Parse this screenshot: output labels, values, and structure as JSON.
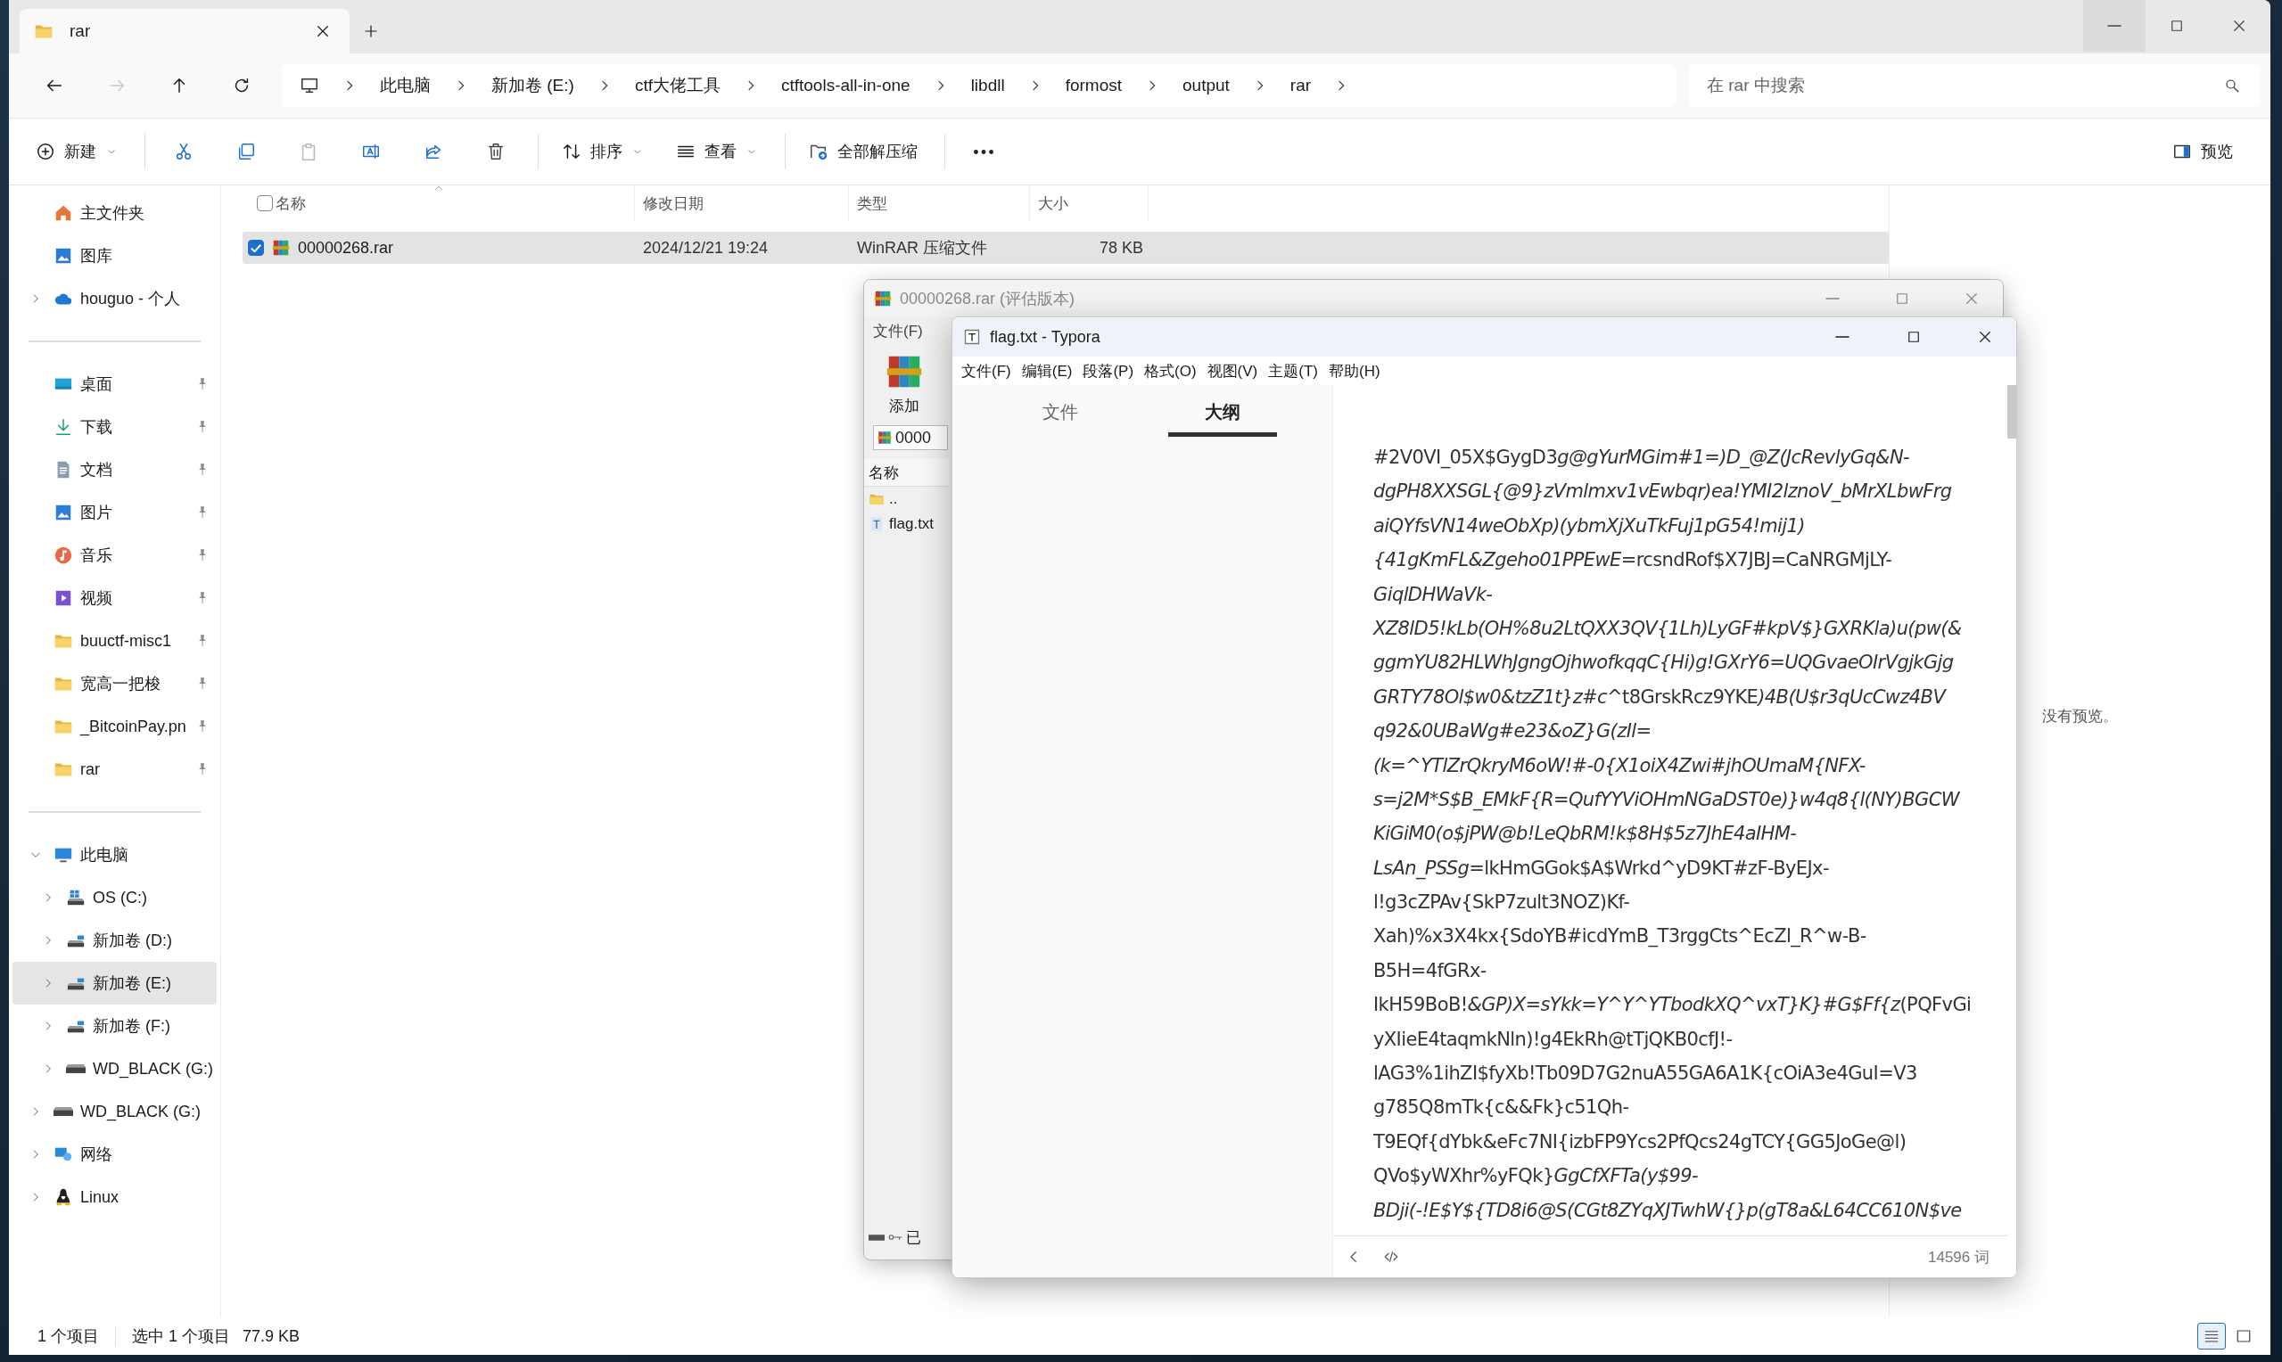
{
  "explorer": {
    "tab": {
      "title": "rar"
    },
    "nav": [
      {
        "kind": "back",
        "disabled": false
      },
      {
        "kind": "forward",
        "disabled": true
      },
      {
        "kind": "up",
        "disabled": false
      },
      {
        "kind": "refresh",
        "disabled": false
      }
    ],
    "breadcrumb": [
      "此电脑",
      "新加卷 (E:)",
      "ctf大佬工具",
      "ctftools-all-in-one",
      "libdll",
      "formost",
      "output",
      "rar"
    ],
    "search": {
      "placeholder": "在 rar 中搜索"
    },
    "toolbar_groups": [
      [
        {
          "kind": "new",
          "label": "新建",
          "dropdown": true,
          "disabled": false
        }
      ],
      [
        {
          "kind": "cut",
          "dropdown": false,
          "disabled": false
        },
        {
          "kind": "copy",
          "dropdown": false,
          "disabled": false
        },
        {
          "kind": "paste",
          "dropdown": false,
          "disabled": true
        },
        {
          "kind": "rename",
          "dropdown": false,
          "disabled": false
        },
        {
          "kind": "share",
          "dropdown": false,
          "disabled": false
        },
        {
          "kind": "delete",
          "dropdown": false,
          "disabled": false
        }
      ],
      [
        {
          "kind": "sort",
          "label": "排序",
          "dropdown": true,
          "disabled": false
        },
        {
          "kind": "view",
          "label": "查看",
          "dropdown": true,
          "disabled": false
        }
      ],
      [
        {
          "kind": "extract",
          "label": "全部解压缩",
          "dropdown": false,
          "disabled": false
        }
      ],
      [
        {
          "kind": "more",
          "dropdown": false,
          "disabled": false
        }
      ]
    ],
    "preview_toggle": {
      "label": "预览"
    },
    "sidebar": {
      "quick": [
        {
          "label": "主文件夹",
          "pinned": false,
          "selected": false
        },
        {
          "label": "图库",
          "pinned": false,
          "selected": false
        },
        {
          "label": "houguo - 个人",
          "expanded": false,
          "pinned": false,
          "selected": false
        }
      ],
      "pinned": [
        {
          "label": "桌面",
          "pinned": true,
          "selected": false
        },
        {
          "label": "下载",
          "pinned": true,
          "selected": false
        },
        {
          "label": "文档",
          "pinned": true,
          "selected": false
        },
        {
          "label": "图片",
          "pinned": true,
          "selected": false
        },
        {
          "label": "音乐",
          "pinned": true,
          "selected": false
        },
        {
          "label": "视频",
          "pinned": true,
          "selected": false
        },
        {
          "label": "buuctf-misc1",
          "pinned": true,
          "selected": false
        },
        {
          "label": "宽高一把梭",
          "pinned": true,
          "selected": false
        },
        {
          "label": "_BitcoinPay.pn",
          "pinned": true,
          "selected": false
        },
        {
          "label": "rar",
          "pinned": true,
          "selected": false
        }
      ],
      "tree": [
        {
          "label": "此电脑",
          "expanded": true,
          "pinned": false,
          "selected": false,
          "children": [
            {
              "label": "OS (C:)",
              "expanded": false,
              "pinned": false,
              "selected": false
            },
            {
              "label": "新加卷 (D:)",
              "expanded": false,
              "pinned": false,
              "selected": false
            },
            {
              "label": "新加卷 (E:)",
              "expanded": false,
              "pinned": false,
              "selected": true
            },
            {
              "label": "新加卷 (F:)",
              "expanded": false,
              "pinned": false,
              "selected": false
            },
            {
              "label": "WD_BLACK (G:)",
              "expanded": false,
              "pinned": false,
              "selected": false
            }
          ]
        },
        {
          "label": "WD_BLACK (G:)",
          "expanded": false,
          "pinned": false,
          "selected": false
        },
        {
          "label": "网络",
          "expanded": false,
          "pinned": false,
          "selected": false
        },
        {
          "label": "Linux",
          "expanded": false,
          "pinned": false,
          "selected": false
        }
      ]
    },
    "header_checkbox": {
      "checked": false
    },
    "columns": [
      {
        "label": "名称",
        "sorted": true
      },
      {
        "label": "修改日期",
        "sorted": false
      },
      {
        "label": "类型",
        "sorted": false
      },
      {
        "label": "大小",
        "sorted": false
      }
    ],
    "files": [
      {
        "name": "00000268.rar",
        "modified": "2024/12/21 19:24",
        "type": "WinRAR 压缩文件",
        "size": "78 KB",
        "selected": true,
        "checked": true
      }
    ],
    "preview": {
      "message": "没有预览。"
    },
    "status_bar": {
      "item_count": "1 个项目",
      "selection": "选中 1 个项目",
      "selection_size": "77.9 KB"
    },
    "view_modes": [
      {
        "kind": "details",
        "selected": true
      },
      {
        "kind": "tiles",
        "selected": false
      }
    ]
  },
  "winrar": {
    "title": "00000268.rar (评估版本)",
    "menu": [
      "文件(F)"
    ],
    "toolbar": [
      {
        "label": "添加"
      }
    ],
    "path": "0000",
    "list_header": "名称",
    "files": [
      {
        "name": "..",
        "kind": "parent"
      },
      {
        "name": "flag.txt",
        "kind": "text"
      }
    ],
    "status": "已"
  },
  "typora": {
    "title": "flag.txt - Typora",
    "menu": [
      "文件(F)",
      "编辑(E)",
      "段落(P)",
      "格式(O)",
      "视图(V)",
      "主题(T)",
      "帮助(H)"
    ],
    "sidebar_tabs": [
      {
        "label": "文件",
        "selected": false
      },
      {
        "label": "大纲",
        "selected": true
      }
    ],
    "lines": [
      [
        {
          "text": "#2V0VI_05X$GygD3",
          "italic": false
        },
        {
          "text": "g@gYurMGim#1=)D_@Z(JcRevlyGq&N-",
          "italic": true
        }
      ],
      [
        {
          "text": "dgPH8XXSGL{@9}zVmlmxv1vEwbqr)ea!YMI2lznoV_bMrXLbwFrg",
          "italic": true
        }
      ],
      [
        {
          "text": "aiQYfsVN14weObXp)(ybmXjXuTkFuj1pG54!mij1)",
          "italic": true
        }
      ],
      [
        {
          "text": "{41gKmFL&Zgeho01PPEwE",
          "italic": true
        },
        {
          "text": "=rcsndRof$X7JBJ=CaNRGMjLY-",
          "italic": false
        }
      ],
      [
        {
          "text": "GiqlDHWaVk-",
          "italic": true
        }
      ],
      [
        {
          "text": "XZ8lD5!kLb(OH%8u2LtQXX3QV{1Lh)LyGF#kpV$}GXRKla)u(pw(&",
          "italic": true
        }
      ],
      [
        {
          "text": "ggmYU82HLWhJgngOjhwofkqqC{Hi)g!GXrY6=UQGvaeOIrVgjkGjg",
          "italic": true
        }
      ],
      [
        {
          "text": "GRTY78Ol$w0&tzZ1t}z#c",
          "italic": true
        },
        {
          "text": "^t8GrskRcz9YKE",
          "italic": false
        },
        {
          "text": ")4B(U$r3qUcCwz4BV",
          "italic": true
        }
      ],
      [
        {
          "text": "q92&0UBaWg#e23&oZ}G(zIl=",
          "italic": true
        }
      ],
      [
        {
          "text": "(k=^YTlZrQkryM6oW!#-0{X1oiX4Zwi#jhOUmaM{NFX-",
          "italic": true
        }
      ],
      [
        {
          "text": "s=j2M*S$B_EMkF{R=QufYYViOHmNGaDST0e)}w4q8{l(NY)BGCW",
          "italic": true
        }
      ],
      [
        {
          "text": "KiGiM0(o$jPW@b!LeQbRM!k$8H$5z7JhE4aIHM-",
          "italic": true
        }
      ],
      [
        {
          "text": "LsAn_PSSg",
          "italic": true
        },
        {
          "text": "=lkHmGGok$A$Wrkd^yD9KT#zF-ByEJx-",
          "italic": false
        }
      ],
      [
        {
          "text": "l!g3cZPAv{SkP7zult3NOZ)Kf-",
          "italic": false
        }
      ],
      [
        {
          "text": "Xah)%x3X4kx{SdoYB#icdYmB_T3rggCts^EcZl_R^w-B-",
          "italic": false
        }
      ],
      [
        {
          "text": "B5H=4fGRx-",
          "italic": false
        }
      ],
      [
        {
          "text": "IkH59BoB!",
          "italic": false
        },
        {
          "text": "&GP)X=sYkk=Y^Y^YTbodkXQ^vxT}K}#G$Ff{z",
          "italic": true
        },
        {
          "text": "(PQFvGi",
          "italic": false
        }
      ],
      [
        {
          "text": "yXIieE4taqmkNln)!g4EkRh@tTjQKB0cfJ!-",
          "italic": false
        }
      ],
      [
        {
          "text": "lAG3%1ihZI$fyXb!Tb09D7G2nuA55GA6A1K{cOiA3e4GuI=V3",
          "italic": false
        }
      ],
      [
        {
          "text": "g785Q8mTk{c&&Fk}c51Qh-",
          "italic": false
        }
      ],
      [
        {
          "text": "T9EQf{dYbk&eFc7NI{izbFP9Ycs2PfQcs24gTCY{GG5JoGe@l)",
          "italic": false
        }
      ],
      [
        {
          "text": "QVo$yWXhr%yFQk}",
          "italic": false
        },
        {
          "text": "GgCfXFTa(y$99-",
          "italic": true
        }
      ],
      [
        {
          "text": "BDji(-!E$Y${TD8i6@S(CGt8ZYqXJTwhW{}p(gT8a&L64CC610N$ve",
          "italic": true
        }
      ]
    ],
    "word_count": "14596 词"
  }
}
